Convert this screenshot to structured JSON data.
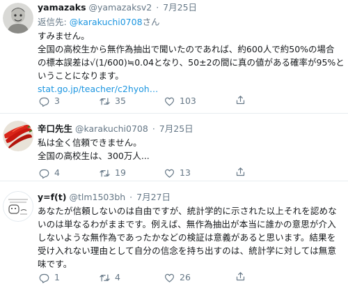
{
  "tweets": [
    {
      "name": "yamazaks",
      "handle": "@yamazaksv2",
      "separator": "·",
      "date": "7月25日",
      "reply_prefix": "返信先: ",
      "reply_to": "@karakuchi0708",
      "reply_suffix": "さん",
      "lines": [
        "すみません。",
        "全国の高校生から無作為抽出で聞いたのであれば、約600人で約50%の場合",
        "の標本誤差は√(1/600)≒0.04となり、50±2の間に真の値がある確率が95%と",
        "いうことになります。"
      ],
      "link": "stat.go.jp/teacher/c2hyoh…",
      "counts": {
        "replies": "3",
        "retweets": "35",
        "likes": "103"
      }
    },
    {
      "name": "辛口先生",
      "handle": "@karakuchi0708",
      "separator": "·",
      "date": "7月25日",
      "lines": [
        "私は全く信頼できません。",
        "全国の高校生は、300万人..."
      ],
      "counts": {
        "replies": "4",
        "retweets": "19",
        "likes": "13"
      }
    },
    {
      "name": "y=f(t)",
      "handle": "@tlm1503bh",
      "separator": "·",
      "date": "7月27日",
      "lines": [
        "あなたが信頼しないのは自由ですが、統計学的に示された以上それを認めな",
        "いのは単なるわがままです。例えば、無作為抽出が本当に誰かの意思が介入",
        "しないような無作為であったかなどの検証は意義があると思います。結果を",
        "受け入れない理由として自分の信念を持ち出すのは、統計学に対しては無意",
        "味です。"
      ],
      "counts": {
        "replies": "1",
        "retweets": "4",
        "likes": "26"
      }
    }
  ],
  "colors": {
    "accent": "#1b95e0",
    "muted": "#657786",
    "text": "#14171a",
    "divider": "#e6ecf0"
  },
  "icons": [
    "reply-icon",
    "retweet-icon",
    "like-icon",
    "share-icon"
  ]
}
